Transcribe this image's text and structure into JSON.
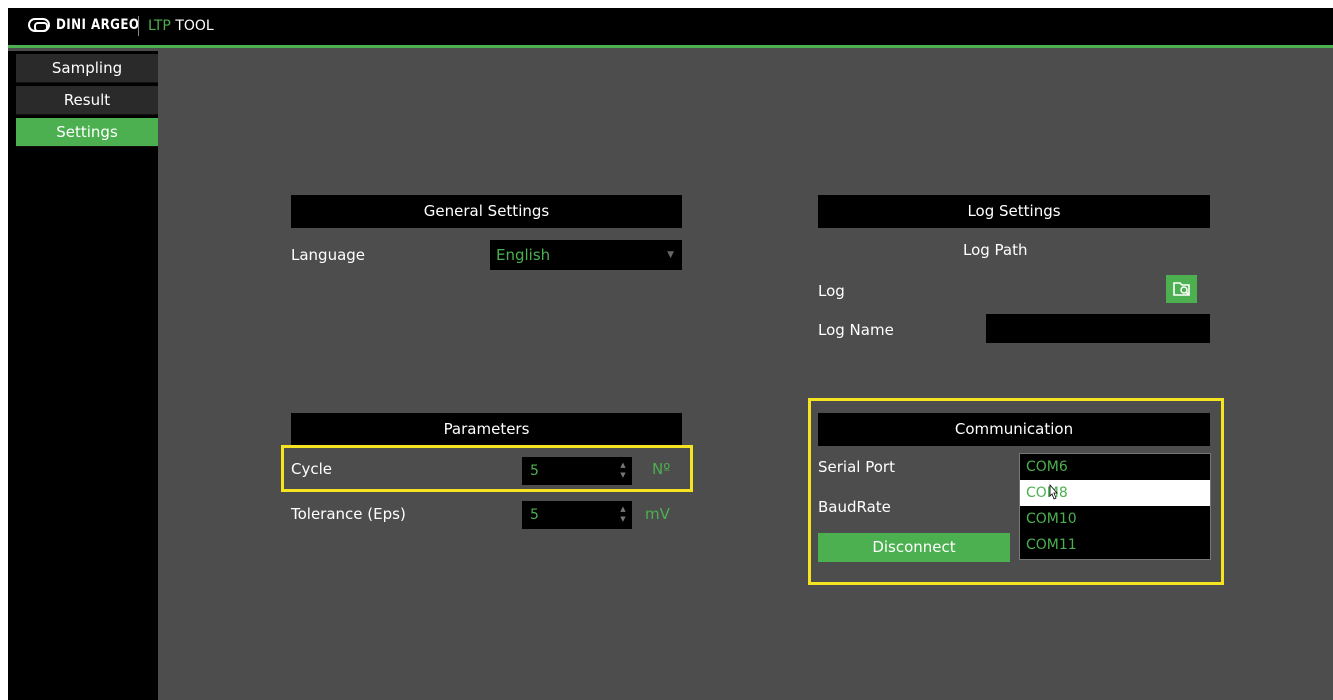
{
  "header": {
    "brand_name": "DINI ARGEO",
    "app_name_prefix": "LTP",
    "app_name_suffix": "TOOL"
  },
  "sidebar": {
    "tabs": [
      {
        "label": "Sampling",
        "active": false
      },
      {
        "label": "Result",
        "active": false
      },
      {
        "label": "Settings",
        "active": true
      }
    ]
  },
  "general_settings": {
    "title": "General Settings",
    "language_label": "Language",
    "language_value": "English"
  },
  "log_settings": {
    "title": "Log Settings",
    "log_path_label": "Log Path",
    "log_label": "Log",
    "log_name_label": "Log Name",
    "log_name_value": "",
    "browse_icon": "folder-search-icon"
  },
  "parameters": {
    "title": "Parameters",
    "cycle_label": "Cycle",
    "cycle_value": "5",
    "cycle_unit": "Nº",
    "tolerance_label": "Tolerance (Eps)",
    "tolerance_value": "5",
    "tolerance_unit": "mV"
  },
  "communication": {
    "title": "Communication",
    "serial_port_label": "Serial Port",
    "baudrate_label": "BaudRate",
    "disconnect_label": "Disconnect",
    "port_options": [
      "COM6",
      "COM8",
      "COM10",
      "COM11"
    ],
    "selected_port": "COM8"
  },
  "colors": {
    "accent": "#4cb050",
    "background": "#4d4d4d",
    "highlight": "#f5e41f"
  }
}
